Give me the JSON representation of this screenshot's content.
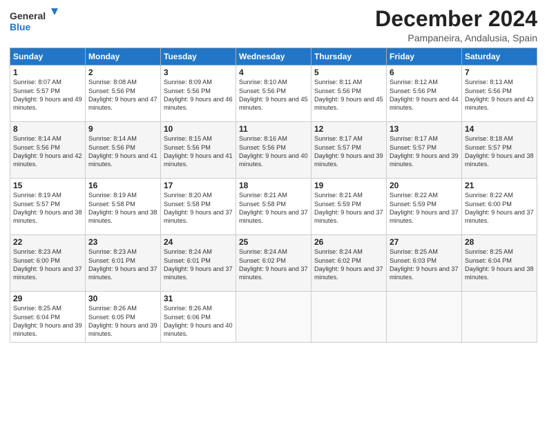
{
  "header": {
    "logo_line1": "General",
    "logo_line2": "Blue",
    "month": "December 2024",
    "location": "Pampaneira, Andalusia, Spain"
  },
  "weekdays": [
    "Sunday",
    "Monday",
    "Tuesday",
    "Wednesday",
    "Thursday",
    "Friday",
    "Saturday"
  ],
  "weeks": [
    [
      {
        "day": "1",
        "sunrise": "8:07 AM",
        "sunset": "5:57 PM",
        "daylight": "9 hours and 49 minutes."
      },
      {
        "day": "2",
        "sunrise": "8:08 AM",
        "sunset": "5:56 PM",
        "daylight": "9 hours and 47 minutes."
      },
      {
        "day": "3",
        "sunrise": "8:09 AM",
        "sunset": "5:56 PM",
        "daylight": "9 hours and 46 minutes."
      },
      {
        "day": "4",
        "sunrise": "8:10 AM",
        "sunset": "5:56 PM",
        "daylight": "9 hours and 45 minutes."
      },
      {
        "day": "5",
        "sunrise": "8:11 AM",
        "sunset": "5:56 PM",
        "daylight": "9 hours and 45 minutes."
      },
      {
        "day": "6",
        "sunrise": "8:12 AM",
        "sunset": "5:56 PM",
        "daylight": "9 hours and 44 minutes."
      },
      {
        "day": "7",
        "sunrise": "8:13 AM",
        "sunset": "5:56 PM",
        "daylight": "9 hours and 43 minutes."
      }
    ],
    [
      {
        "day": "8",
        "sunrise": "8:14 AM",
        "sunset": "5:56 PM",
        "daylight": "9 hours and 42 minutes."
      },
      {
        "day": "9",
        "sunrise": "8:14 AM",
        "sunset": "5:56 PM",
        "daylight": "9 hours and 41 minutes."
      },
      {
        "day": "10",
        "sunrise": "8:15 AM",
        "sunset": "5:56 PM",
        "daylight": "9 hours and 41 minutes."
      },
      {
        "day": "11",
        "sunrise": "8:16 AM",
        "sunset": "5:56 PM",
        "daylight": "9 hours and 40 minutes."
      },
      {
        "day": "12",
        "sunrise": "8:17 AM",
        "sunset": "5:57 PM",
        "daylight": "9 hours and 39 minutes."
      },
      {
        "day": "13",
        "sunrise": "8:17 AM",
        "sunset": "5:57 PM",
        "daylight": "9 hours and 39 minutes."
      },
      {
        "day": "14",
        "sunrise": "8:18 AM",
        "sunset": "5:57 PM",
        "daylight": "9 hours and 38 minutes."
      }
    ],
    [
      {
        "day": "15",
        "sunrise": "8:19 AM",
        "sunset": "5:57 PM",
        "daylight": "9 hours and 38 minutes."
      },
      {
        "day": "16",
        "sunrise": "8:19 AM",
        "sunset": "5:58 PM",
        "daylight": "9 hours and 38 minutes."
      },
      {
        "day": "17",
        "sunrise": "8:20 AM",
        "sunset": "5:58 PM",
        "daylight": "9 hours and 37 minutes."
      },
      {
        "day": "18",
        "sunrise": "8:21 AM",
        "sunset": "5:58 PM",
        "daylight": "9 hours and 37 minutes."
      },
      {
        "day": "19",
        "sunrise": "8:21 AM",
        "sunset": "5:59 PM",
        "daylight": "9 hours and 37 minutes."
      },
      {
        "day": "20",
        "sunrise": "8:22 AM",
        "sunset": "5:59 PM",
        "daylight": "9 hours and 37 minutes."
      },
      {
        "day": "21",
        "sunrise": "8:22 AM",
        "sunset": "6:00 PM",
        "daylight": "9 hours and 37 minutes."
      }
    ],
    [
      {
        "day": "22",
        "sunrise": "8:23 AM",
        "sunset": "6:00 PM",
        "daylight": "9 hours and 37 minutes."
      },
      {
        "day": "23",
        "sunrise": "8:23 AM",
        "sunset": "6:01 PM",
        "daylight": "9 hours and 37 minutes."
      },
      {
        "day": "24",
        "sunrise": "8:24 AM",
        "sunset": "6:01 PM",
        "daylight": "9 hours and 37 minutes."
      },
      {
        "day": "25",
        "sunrise": "8:24 AM",
        "sunset": "6:02 PM",
        "daylight": "9 hours and 37 minutes."
      },
      {
        "day": "26",
        "sunrise": "8:24 AM",
        "sunset": "6:02 PM",
        "daylight": "9 hours and 37 minutes."
      },
      {
        "day": "27",
        "sunrise": "8:25 AM",
        "sunset": "6:03 PM",
        "daylight": "9 hours and 37 minutes."
      },
      {
        "day": "28",
        "sunrise": "8:25 AM",
        "sunset": "6:04 PM",
        "daylight": "9 hours and 38 minutes."
      }
    ],
    [
      {
        "day": "29",
        "sunrise": "8:25 AM",
        "sunset": "6:04 PM",
        "daylight": "9 hours and 39 minutes."
      },
      {
        "day": "30",
        "sunrise": "8:26 AM",
        "sunset": "6:05 PM",
        "daylight": "9 hours and 39 minutes."
      },
      {
        "day": "31",
        "sunrise": "8:26 AM",
        "sunset": "6:06 PM",
        "daylight": "9 hours and 40 minutes."
      },
      null,
      null,
      null,
      null
    ]
  ]
}
